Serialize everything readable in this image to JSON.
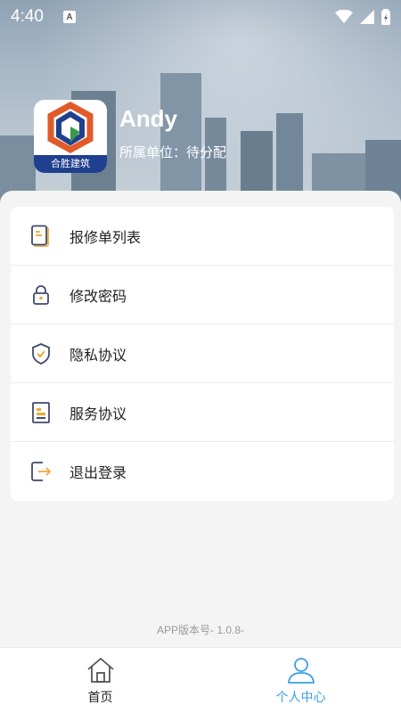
{
  "status_bar": {
    "time": "4:40",
    "notification_icon": "A"
  },
  "profile": {
    "name": "Andy",
    "unit": "所属单位：待分配",
    "logo_text": "合胜建筑"
  },
  "menu": {
    "items": [
      {
        "label": "报修单列表",
        "icon": "document-list-icon"
      },
      {
        "label": "修改密码",
        "icon": "lock-icon"
      },
      {
        "label": "隐私协议",
        "icon": "shield-check-icon"
      },
      {
        "label": "服务协议",
        "icon": "service-document-icon"
      },
      {
        "label": "退出登录",
        "icon": "logout-icon"
      }
    ]
  },
  "version": "APP版本号- 1.0.8-",
  "tabs": [
    {
      "label": "首页",
      "icon": "home-icon",
      "active": false
    },
    {
      "label": "个人中心",
      "icon": "user-icon",
      "active": true
    }
  ],
  "colors": {
    "accent": "#3a9de8",
    "icon_primary": "#3f4a6e",
    "icon_secondary": "#f2a838"
  }
}
